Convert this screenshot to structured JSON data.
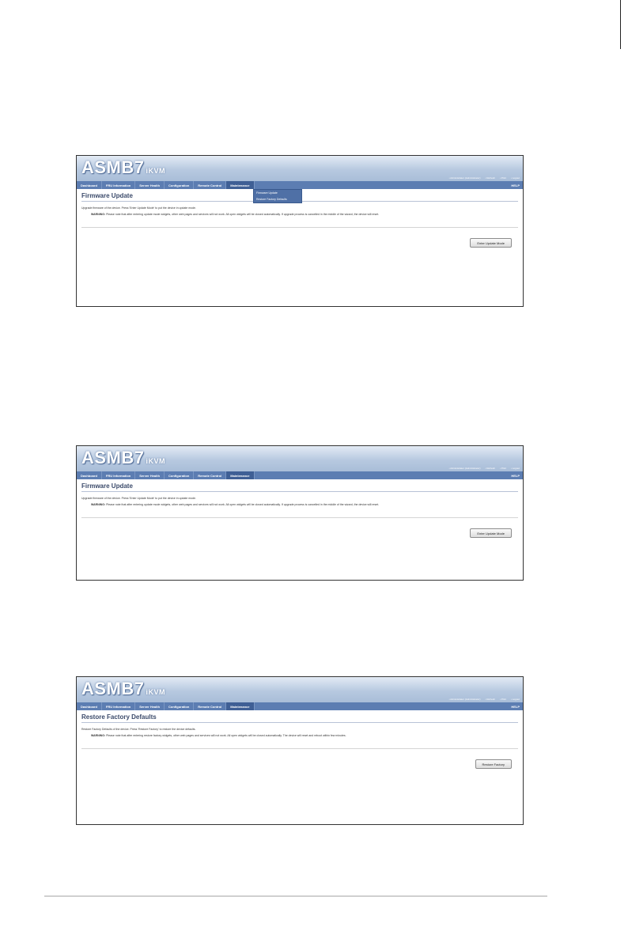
{
  "screens": [
    {
      "brand": "ASMB7",
      "brand_sub": "iKVM",
      "top_links": [
        "• Administrator (Administrator)",
        "• Refresh",
        "• Print",
        "• Logout"
      ],
      "nav": [
        "Dashboard",
        "FRU Information",
        "Server Health",
        "Configuration",
        "Remote Control",
        "Maintenance"
      ],
      "nav_active": "Maintenance",
      "help": "HELP",
      "dropdown": [
        "Firmware Update",
        "Restore Factory Defaults"
      ],
      "title": "Firmware Update",
      "description": "Upgrade firmware of the device. Press 'Enter Update Mode' to put the device in update mode.",
      "warning_label": "WARNING:",
      "warning_text": "Please note that after entering update mode widgets, other web pages and services will not work. All open widgets will be closed automatically. If upgrade process is cancelled in the middle of the wizard, the device will reset.",
      "button": "Enter Update Mode"
    },
    {
      "brand": "ASMB7",
      "brand_sub": "iKVM",
      "top_links": [
        "• Administrator (Administrator)",
        "• Refresh",
        "• Print",
        "• Logout"
      ],
      "nav": [
        "Dashboard",
        "FRU Information",
        "Server Health",
        "Configuration",
        "Remote Control",
        "Maintenance"
      ],
      "nav_active": "Maintenance",
      "help": "HELP",
      "title": "Firmware Update",
      "description": "Upgrade firmware of the device. Press 'Enter Update Mode' to put the device in update mode.",
      "warning_label": "WARNING:",
      "warning_text": "Please note that after entering update mode widgets, other web pages and services will not work. All open widgets will be closed automatically. If upgrade process is cancelled in the middle of the wizard, the device will reset.",
      "button": "Enter Update Mode"
    },
    {
      "brand": "ASMB7",
      "brand_sub": "iKVM",
      "top_links": [
        "• Administrator (Administrator)",
        "• Refresh",
        "• Print",
        "• Logout"
      ],
      "nav": [
        "Dashboard",
        "FRU Information",
        "Server Health",
        "Configuration",
        "Remote Control",
        "Maintenance"
      ],
      "nav_active": "Maintenance",
      "help": "HELP",
      "title": "Restore Factory Defaults",
      "description": "Restore Factory Defaults of the device. Press 'Restore Factory' to restore the device defaults.",
      "warning_label": "WARNING:",
      "warning_text": "Please note that after entering restore factory widgets, other web pages and services will not work. All open widgets will be closed automatically. The device will reset and reboot within few minutes.",
      "button": "Restore Factory"
    }
  ]
}
